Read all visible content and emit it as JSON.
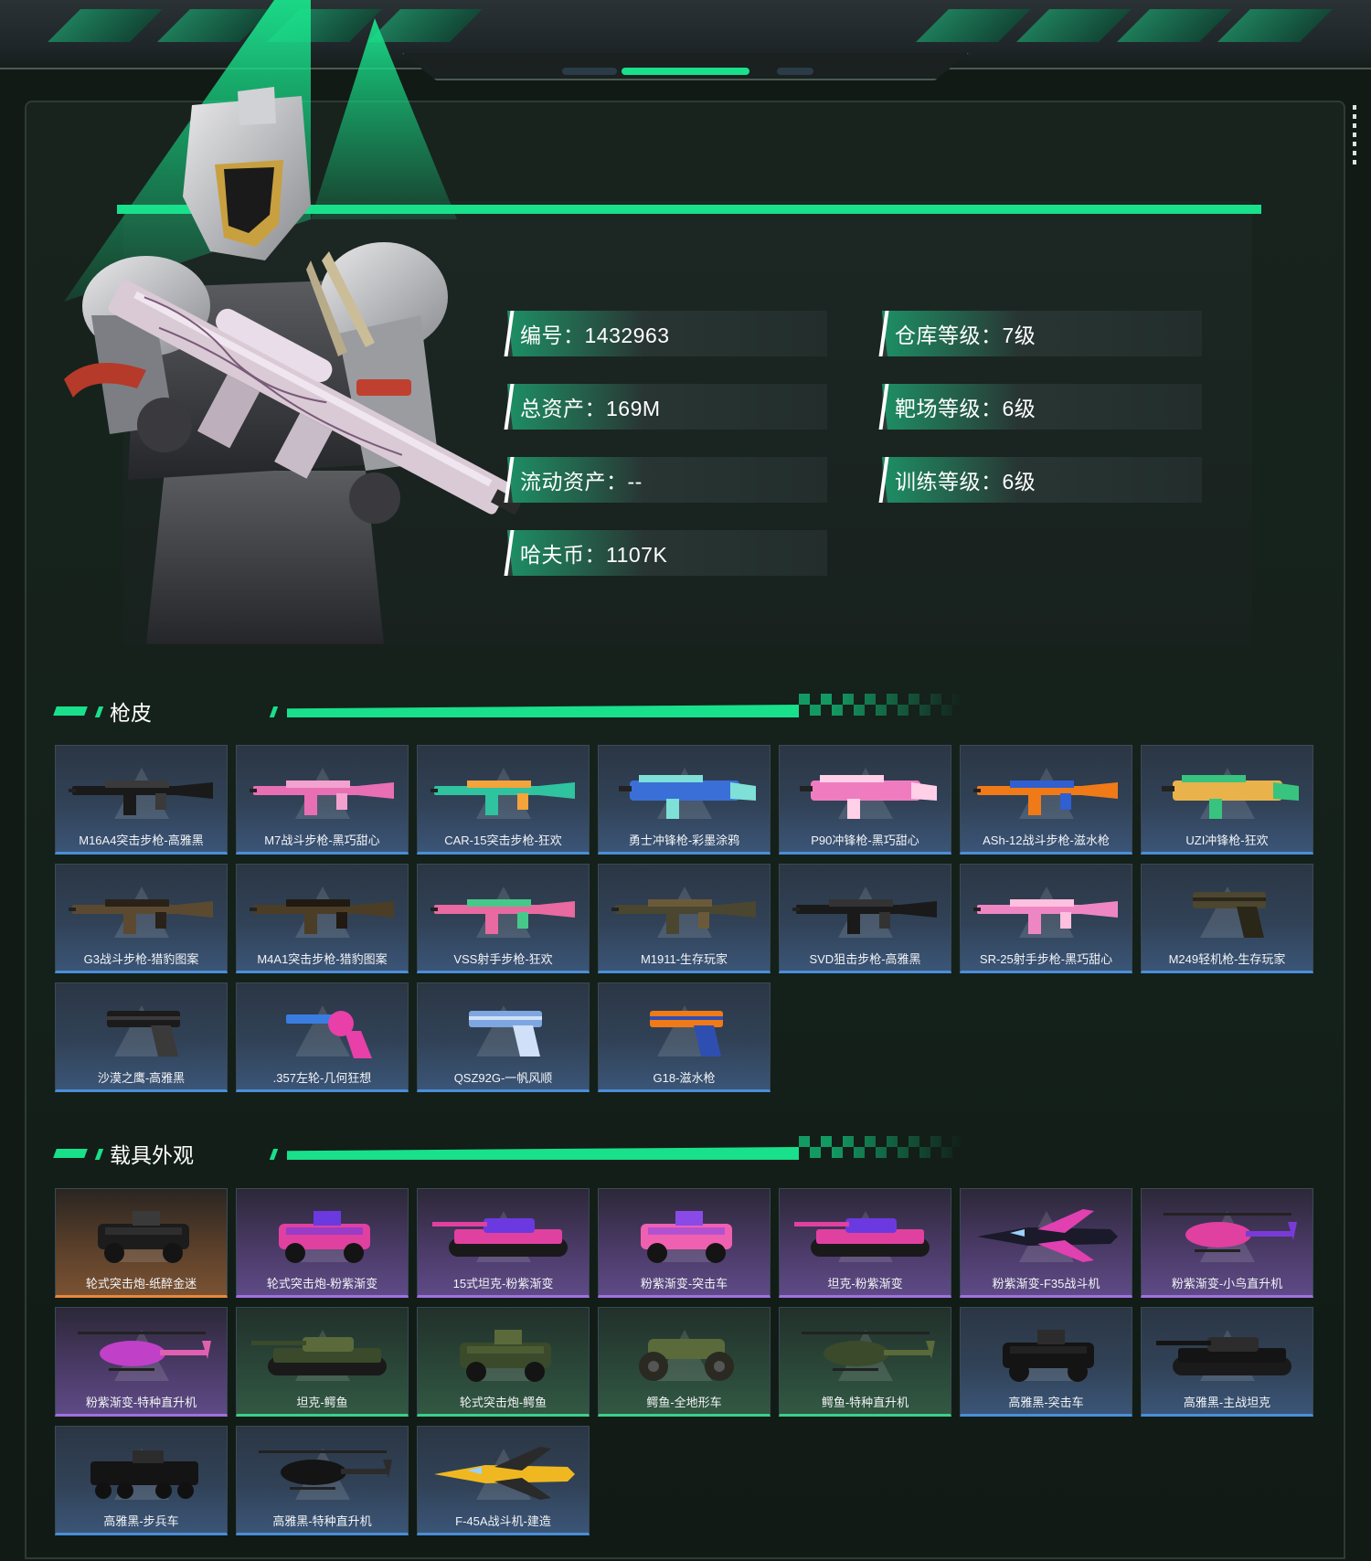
{
  "profile": {
    "stats_left": [
      {
        "label": "编号：1432963"
      },
      {
        "label": "总资产：169M"
      },
      {
        "label": "流动资产：--"
      },
      {
        "label": "哈夫币：1107K"
      }
    ],
    "stats_right": [
      {
        "label": "仓库等级：7级"
      },
      {
        "label": "靶场等级：6级"
      },
      {
        "label": "训练等级：6级"
      }
    ]
  },
  "sections": {
    "guns": {
      "title": "枪皮",
      "items": [
        {
          "name": "M16A4突击步枪-高雅黑",
          "rarity": "blue",
          "icon": "rifle-icon",
          "colors": [
            "#1a1a1a",
            "#3a3a3a"
          ]
        },
        {
          "name": "M7战斗步枪-黑巧甜心",
          "rarity": "blue",
          "icon": "rifle-icon",
          "colors": [
            "#e86fb4",
            "#f3a2d0"
          ]
        },
        {
          "name": "CAR-15突击步枪-狂欢",
          "rarity": "blue",
          "icon": "rifle-icon",
          "colors": [
            "#2fc3a0",
            "#f5a33b"
          ]
        },
        {
          "name": "勇士冲锋枪-彩墨涂鸦",
          "rarity": "blue",
          "icon": "smg-icon",
          "colors": [
            "#3b6fd8",
            "#7ee0d6"
          ]
        },
        {
          "name": "P90冲锋枪-黑巧甜心",
          "rarity": "blue",
          "icon": "smg-icon",
          "colors": [
            "#f07cc0",
            "#ffd0e8"
          ]
        },
        {
          "name": "ASh-12战斗步枪-滋水枪",
          "rarity": "blue",
          "icon": "rifle-icon",
          "colors": [
            "#f07a18",
            "#2f5fd0"
          ]
        },
        {
          "name": "UZI冲锋枪-狂欢",
          "rarity": "blue",
          "icon": "smg-icon",
          "colors": [
            "#e9b24a",
            "#38c47f"
          ]
        },
        {
          "name": "G3战斗步枪-猎豹图案",
          "rarity": "blue",
          "icon": "rifle-icon",
          "colors": [
            "#5b4a30",
            "#2a2218"
          ]
        },
        {
          "name": "M4A1突击步枪-猎豹图案",
          "rarity": "blue",
          "icon": "rifle-icon",
          "colors": [
            "#4c3d26",
            "#201a12"
          ]
        },
        {
          "name": "VSS射手步枪-狂欢",
          "rarity": "blue",
          "icon": "rifle-icon",
          "colors": [
            "#e86aa0",
            "#47c88b"
          ]
        },
        {
          "name": "M1911-生存玩家",
          "rarity": "blue",
          "icon": "rifle-icon",
          "colors": [
            "#4a4630",
            "#6b5a3a"
          ]
        },
        {
          "name": "SVD狙击步枪-高雅黑",
          "rarity": "blue",
          "icon": "rifle-icon",
          "colors": [
            "#1a1a1a",
            "#333333"
          ]
        },
        {
          "name": "SR-25射手步枪-黑巧甜心",
          "rarity": "blue",
          "icon": "rifle-icon",
          "colors": [
            "#ef86c4",
            "#ffc0e0"
          ]
        },
        {
          "name": "M249轻机枪-生存玩家",
          "rarity": "blue",
          "icon": "pistol-icon",
          "colors": [
            "#4d4630",
            "#2a2618"
          ]
        },
        {
          "name": "沙漠之鹰-高雅黑",
          "rarity": "blue",
          "icon": "pistol-icon",
          "colors": [
            "#1b1b1b",
            "#3a3a3a"
          ]
        },
        {
          "name": ".357左轮-几何狂想",
          "rarity": "blue",
          "icon": "revolver-icon",
          "colors": [
            "#e93fa8",
            "#3a7de0"
          ]
        },
        {
          "name": "QSZ92G-一帆风顺",
          "rarity": "blue",
          "icon": "pistol-icon",
          "colors": [
            "#7ea6e0",
            "#cfe0f8"
          ]
        },
        {
          "name": "G18-滋水枪",
          "rarity": "blue",
          "icon": "pistol-icon",
          "colors": [
            "#f07a18",
            "#2f4fb0"
          ]
        }
      ]
    },
    "vehicles": {
      "title": "载具外观",
      "items": [
        {
          "name": "轮式突击炮-纸醉金迷",
          "rarity": "orange",
          "icon": "armored-car-icon",
          "colors": [
            "#1c1c1c",
            "#3a3a3a"
          ]
        },
        {
          "name": "轮式突击炮-粉紫渐变",
          "rarity": "purple",
          "icon": "armored-car-icon",
          "colors": [
            "#e040a0",
            "#6a3ae0"
          ]
        },
        {
          "name": "15式坦克-粉紫渐变",
          "rarity": "purple",
          "icon": "tank-icon",
          "colors": [
            "#e040a0",
            "#6a3ae0"
          ]
        },
        {
          "name": "粉紫渐变-突击车",
          "rarity": "purple",
          "icon": "armored-car-icon",
          "colors": [
            "#f060b0",
            "#8a4ae8"
          ]
        },
        {
          "name": "坦克-粉紫渐变",
          "rarity": "purple",
          "icon": "tank-icon",
          "colors": [
            "#e040a0",
            "#6a3ae0"
          ]
        },
        {
          "name": "粉紫渐变-F35战斗机",
          "rarity": "purple",
          "icon": "jet-icon",
          "colors": [
            "#1a1a2a",
            "#e040b0"
          ]
        },
        {
          "name": "粉紫渐变-小鸟直升机",
          "rarity": "purple",
          "icon": "helicopter-icon",
          "colors": [
            "#e040a0",
            "#7a3ad8"
          ]
        },
        {
          "name": "粉紫渐变-特种直升机",
          "rarity": "purple",
          "icon": "helicopter-icon",
          "colors": [
            "#c040c8",
            "#e060b0"
          ]
        },
        {
          "name": "坦克-鳄鱼",
          "rarity": "green",
          "icon": "tank-icon",
          "colors": [
            "#3a4a2a",
            "#5a6a3a"
          ]
        },
        {
          "name": "轮式突击炮-鳄鱼",
          "rarity": "green",
          "icon": "armored-car-icon",
          "colors": [
            "#3a4a2a",
            "#5a6a3a"
          ]
        },
        {
          "name": "鳄鱼-全地形车",
          "rarity": "green",
          "icon": "atv-icon",
          "colors": [
            "#2a2a22",
            "#5a6a3a"
          ]
        },
        {
          "name": "鳄鱼-特种直升机",
          "rarity": "green",
          "icon": "helicopter-icon",
          "colors": [
            "#3a4a2a",
            "#5a6a3a"
          ]
        },
        {
          "name": "高雅黑-突击车",
          "rarity": "blue",
          "icon": "armored-car-icon",
          "colors": [
            "#141414",
            "#2c2c2c"
          ]
        },
        {
          "name": "高雅黑-主战坦克",
          "rarity": "blue",
          "icon": "tank-icon",
          "colors": [
            "#141414",
            "#2c2c2c"
          ]
        },
        {
          "name": "高雅黑-步兵车",
          "rarity": "blue",
          "icon": "ifv-icon",
          "colors": [
            "#141414",
            "#2c2c2c"
          ]
        },
        {
          "name": "高雅黑-特种直升机",
          "rarity": "blue",
          "icon": "helicopter-icon",
          "colors": [
            "#141414",
            "#2c2c2c"
          ]
        },
        {
          "name": "F-45A战斗机-建造",
          "rarity": "blue",
          "icon": "jet-icon",
          "colors": [
            "#f0b820",
            "#2a2a2a"
          ]
        }
      ]
    }
  },
  "theme": {
    "accent": "#19e08a",
    "background": "#121a16"
  }
}
